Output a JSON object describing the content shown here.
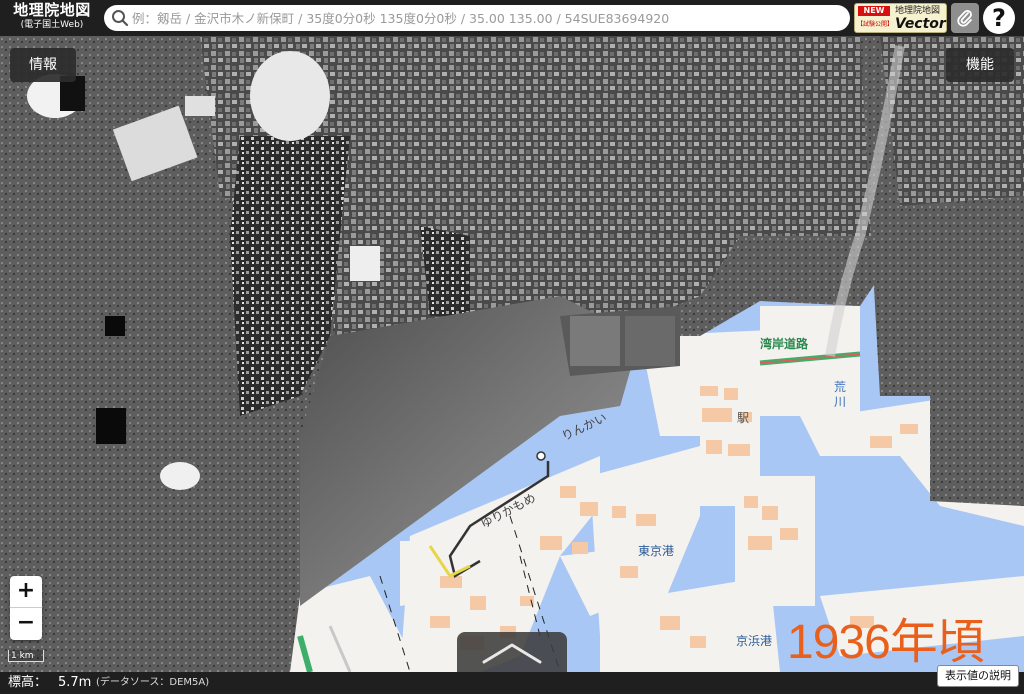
{
  "header": {
    "logo_main": "地理院地図",
    "logo_sub": "(電子国土Web)",
    "search_placeholder": "例：剱岳 / 金沢市木ノ新保町 / 35度0分0秒 135度0分0秒 / 35.00 135.00 / 54SUE83694920",
    "vector_new_badge": "NEW",
    "vector_trial": "【試験公開】",
    "vector_line1": "地理院地図",
    "vector_line2": "Vector",
    "help_label": "?"
  },
  "buttons": {
    "info": "情報",
    "functions": "機能",
    "zoom_in": "+",
    "zoom_out": "−",
    "explain": "表示値の説明"
  },
  "scale_bar": "1 km",
  "map_labels": {
    "wangan_road": "湾岸道路",
    "arakawa_1": "荒",
    "arakawa_2": "川",
    "station": "駅",
    "rinkai": "りんかい",
    "yurikamome": "ゆりかもめ",
    "tokyo_port": "東京港",
    "keihin_port": "京浜港"
  },
  "overlay": {
    "year": "1936年頃"
  },
  "footer": {
    "elevation_label": "標高：",
    "elevation_value": "5.7m",
    "data_source": "(データソース：DEM5A)"
  },
  "colors": {
    "header_bg": "#1f1f1f",
    "sea": "#a9c7f5",
    "land": "#f4f2ee",
    "building": "#f6c9a6",
    "year_text": "#e8601c",
    "expressway": "#3daf6a"
  },
  "icons": {
    "search": "search-icon",
    "clip": "paperclip-icon",
    "pull_up": "chevron-up-icon"
  }
}
